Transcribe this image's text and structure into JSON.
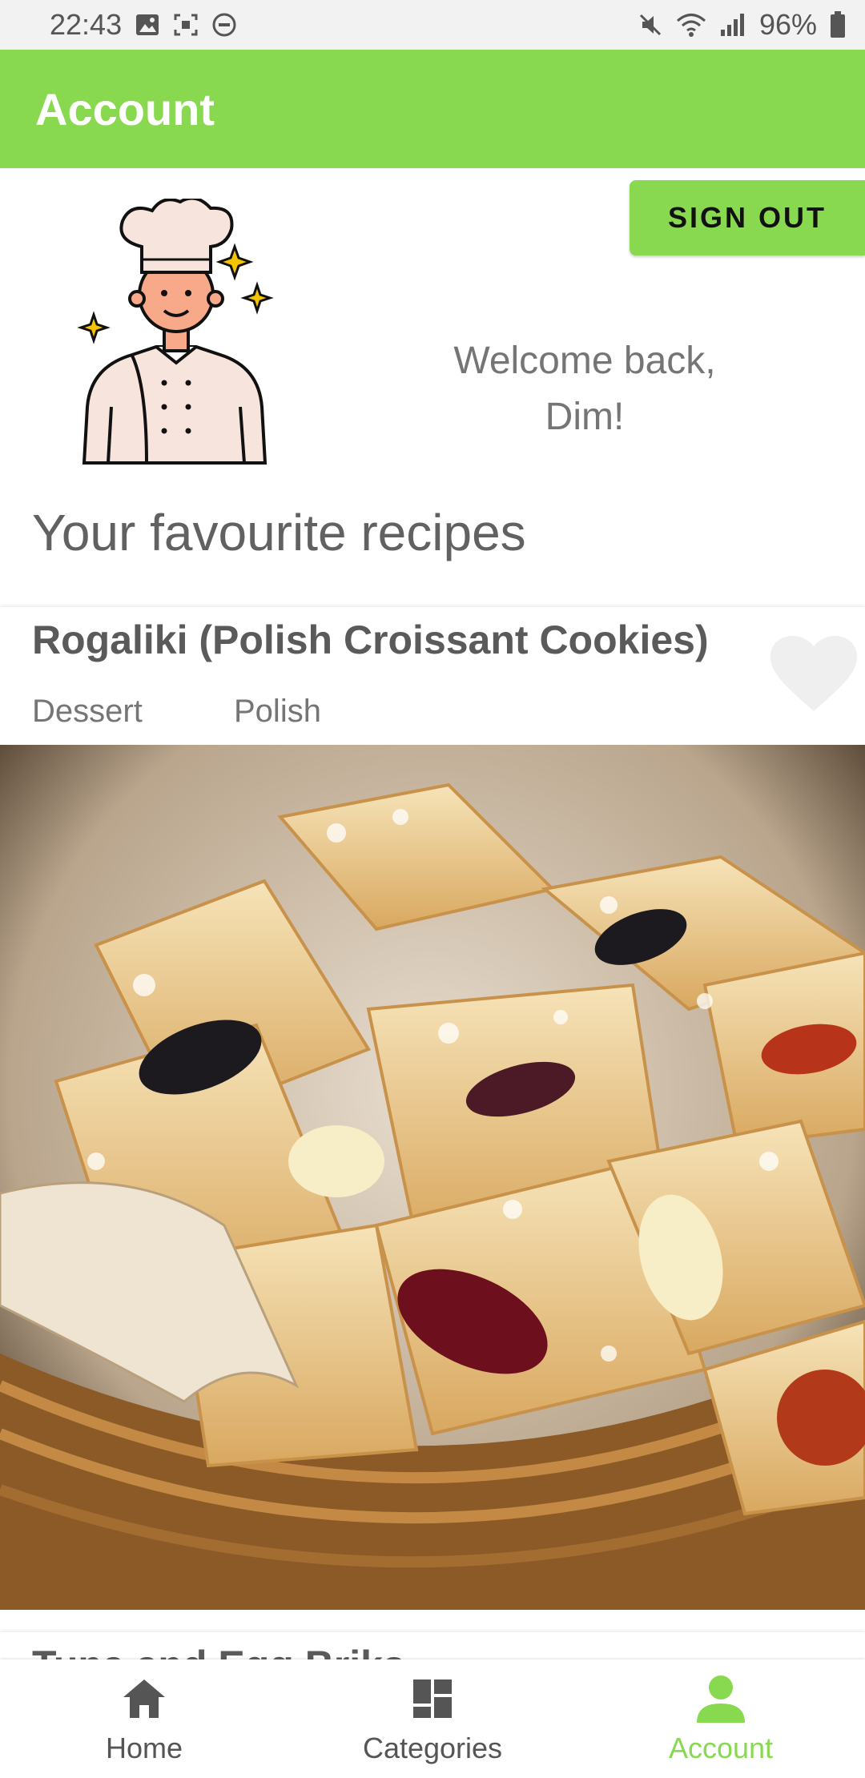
{
  "status_bar": {
    "time": "22:43",
    "battery": "96%",
    "left_icons": [
      "image-icon",
      "screenshot-icon",
      "dnd-icon"
    ],
    "right_icons": [
      "mute-icon",
      "wifi-icon",
      "signal-icon",
      "battery-icon"
    ]
  },
  "appbar": {
    "title": "Account"
  },
  "profile": {
    "sign_out_label": "SIGN OUT",
    "welcome_line1": "Welcome back,",
    "welcome_line2": "Dim!",
    "avatar_icon": "chef-avatar-icon"
  },
  "favourites": {
    "section_title": "Your favourite recipes",
    "recipes": [
      {
        "title": "Rogaliki (Polish Croissant Cookies)",
        "category": "Dessert",
        "area": "Polish",
        "favourite_icon": "heart-icon"
      },
      {
        "title": "Tuna and Egg Briks"
      }
    ]
  },
  "bottom_nav": {
    "items": [
      {
        "label": "Home",
        "icon": "home-icon"
      },
      {
        "label": "Categories",
        "icon": "categories-icon"
      },
      {
        "label": "Account",
        "icon": "account-icon"
      }
    ],
    "active_index": 2
  },
  "colors": {
    "accent": "#88d94f",
    "status_bar_bg": "#f2f2f2",
    "text_muted": "#757575"
  }
}
